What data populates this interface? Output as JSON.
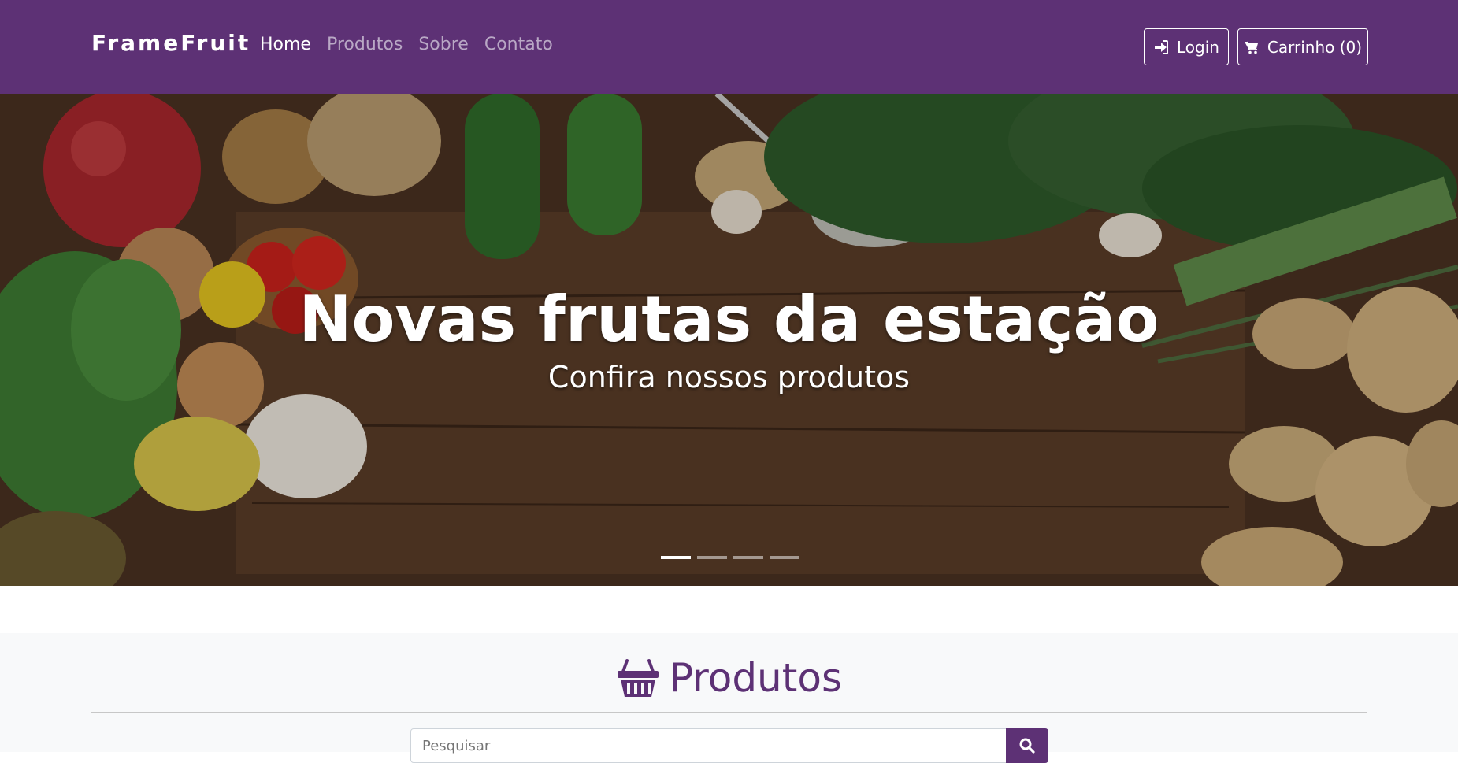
{
  "navbar": {
    "brand": "FrameFruit",
    "links": [
      {
        "label": "Home",
        "active": true
      },
      {
        "label": "Produtos",
        "active": false
      },
      {
        "label": "Sobre",
        "active": false
      },
      {
        "label": "Contato",
        "active": false
      }
    ],
    "login_label": "Login",
    "cart_label": "Carrinho (0)",
    "login_icon": "sign-in-icon",
    "cart_icon": "shopping-cart-icon"
  },
  "hero": {
    "title": "Novas frutas da estação",
    "subtitle": "Confira nossos produtos",
    "slides_count": 4,
    "active_slide": 1
  },
  "products": {
    "heading": "Produtos",
    "heading_icon": "shopping-basket-icon",
    "search_placeholder": "Pesquisar",
    "search_icon": "search-icon"
  },
  "colors": {
    "brand_purple": "#5d3175",
    "nav_link_inactive": "#b9a8c5",
    "section_bg": "#f8f9fa"
  }
}
